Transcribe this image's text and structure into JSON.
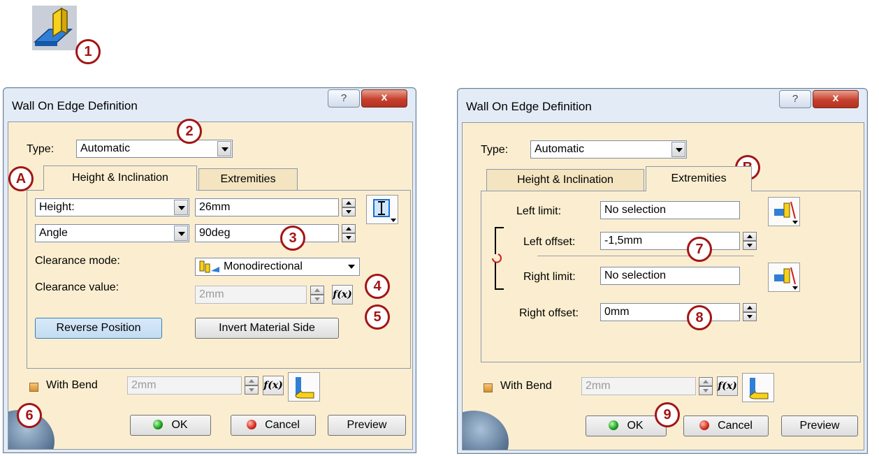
{
  "callouts": {
    "c1": "1",
    "c2": "2",
    "c3": "3",
    "c4": "4",
    "c5": "5",
    "c6": "6",
    "c7": "7",
    "c8": "8",
    "c9": "9",
    "cA": "A",
    "cB": "B"
  },
  "dialog_left": {
    "title": "Wall On Edge Definition",
    "help": "?",
    "close": "x",
    "type_label": "Type:",
    "type_value": "Automatic",
    "tabs": [
      "Height & Inclination",
      "Extremities"
    ],
    "active_tab": "Height & Inclination",
    "height_mode": "Height:",
    "height_value": "26mm",
    "angle_mode": "Angle",
    "angle_value": "90deg",
    "clearance_mode_label": "Clearance mode:",
    "clearance_mode_value": "Monodirectional",
    "clearance_value_label": "Clearance value:",
    "clearance_value": "2mm",
    "reverse_position": "Reverse Position",
    "invert_material_side": "Invert Material Side",
    "with_bend_label": "With Bend",
    "bend_radius": "2mm",
    "fx_label": "f(x)",
    "ok": "OK",
    "cancel": "Cancel",
    "preview": "Preview"
  },
  "dialog_right": {
    "title": "Wall On Edge Definition",
    "help": "?",
    "close": "x",
    "type_label": "Type:",
    "type_value": "Automatic",
    "tabs": [
      "Height & Inclination",
      "Extremities"
    ],
    "active_tab": "Extremities",
    "left_limit_label": "Left limit:",
    "left_limit_value": "No selection",
    "left_offset_label": "Left offset:",
    "left_offset_value": "-1,5mm",
    "right_limit_label": "Right limit:",
    "right_limit_value": "No selection",
    "right_offset_label": "Right offset:",
    "right_offset_value": "0mm",
    "with_bend_label": "With Bend",
    "bend_radius": "2mm",
    "fx_label": "f(x)",
    "ok": "OK",
    "cancel": "Cancel",
    "preview": "Preview"
  },
  "colors": {
    "callout": "#a31515",
    "client_bg": "#fbeed0",
    "title_bg": "#e3ecf6",
    "close_red": "#c6402d"
  },
  "icons": [
    "wall-on-edge-icon",
    "help-icon",
    "close-icon",
    "height-mode-icon",
    "clearance-mode-icon",
    "fx-icon",
    "bend-icon",
    "limit-select-icon",
    "swap-icon"
  ]
}
